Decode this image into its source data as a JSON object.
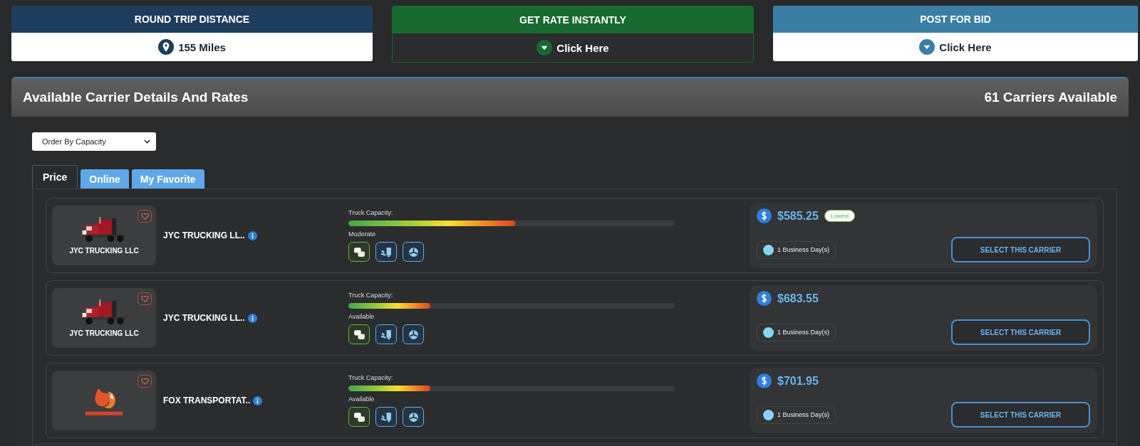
{
  "summary_cards": [
    {
      "kind": "distance",
      "title": "ROUND TRIP DISTANCE",
      "value": "155 Miles"
    },
    {
      "kind": "rate",
      "title": "GET RATE INSTANTLY",
      "value": "Click Here"
    },
    {
      "kind": "bid",
      "title": "POST FOR BID",
      "value": "Click Here"
    }
  ],
  "panel": {
    "title": "Available Carrier Details And Rates",
    "count": "61 Carriers Available"
  },
  "sort_select": {
    "value": "Order By Capacity"
  },
  "tabs": [
    {
      "label": "Price",
      "selected": true
    },
    {
      "label": "Online",
      "selected": false
    },
    {
      "label": "My Favorite",
      "selected": false
    }
  ],
  "carriers": [
    {
      "kind": "truck",
      "logo_text": "JYC TRUCKING LLC",
      "name": "JYC TRUCKING LL..",
      "capacity_label": "Truck Capacity:",
      "level": 0.51,
      "status": "Moderate",
      "price": "$585.25",
      "badge": "Lowest",
      "transit": "1 Business Day(s)",
      "button": "SELECT THIS CARRIER"
    },
    {
      "kind": "truck",
      "logo_text": "JYC TRUCKING LLC",
      "name": "JYC TRUCKING LL..",
      "capacity_label": "Truck Capacity:",
      "level": 0.25,
      "status": "Available",
      "price": "$683.55",
      "transit": "1 Business Day(s)",
      "button": "SELECT THIS CARRIER"
    },
    {
      "kind": "fox",
      "name": "FOX TRANSPORTAT..",
      "capacity_label": "Truck Capacity:",
      "level": 0.25,
      "status": "Available",
      "price": "$701.95",
      "transit": "1 Business Day(s)",
      "button": "SELECT THIS CARRIER"
    }
  ]
}
